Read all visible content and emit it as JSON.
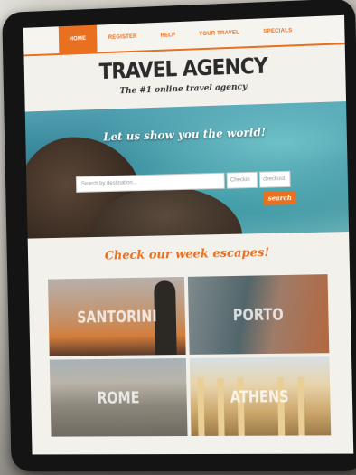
{
  "nav": {
    "items": [
      {
        "label": "HOME",
        "active": true
      },
      {
        "label": "REGISTER",
        "active": false
      },
      {
        "label": "HELP",
        "active": false
      },
      {
        "label": "YOUR TRAVEL",
        "active": false
      },
      {
        "label": "SPECIALS",
        "active": false
      }
    ]
  },
  "header": {
    "title": "TRAVEL AGENCY",
    "tagline": "The #1 online travel agency"
  },
  "hero": {
    "headline": "Let us show you the world!",
    "search_placeholder": "Search by destination...",
    "checkin_placeholder": "Checkin",
    "checkout_placeholder": "checkout",
    "search_button": "search"
  },
  "escapes": {
    "title": "Check our week escapes!",
    "tiles": [
      "SANTORINI",
      "PORTO",
      "ROME",
      "ATHENS"
    ]
  },
  "colors": {
    "accent": "#e8701f",
    "page_bg": "#f3f1ec",
    "tablet_frame": "#141414"
  }
}
